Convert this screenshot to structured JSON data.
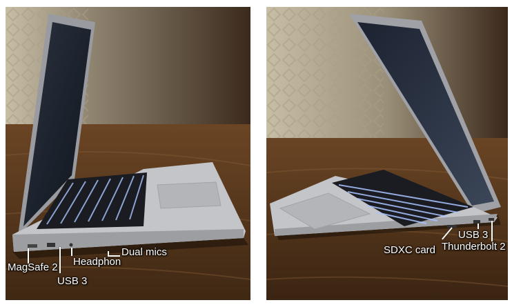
{
  "panels": [
    {
      "labels": {
        "magsafe": "MagSafe 2",
        "usb": "USB 3",
        "headphone": "Headphon",
        "mics": "Dual mics"
      }
    },
    {
      "labels": {
        "sdxc": "SDXC card",
        "usb": "USB 3",
        "thunderbolt": "Thunderbolt 2"
      }
    }
  ],
  "colors": {
    "table_wood": "#5a3a1f",
    "wallpaper": "#b8ad95",
    "laptop_aluminium": "#bdbdbf",
    "keyboard_backlight": "#a9c4ff",
    "label_text": "#ffffff"
  }
}
